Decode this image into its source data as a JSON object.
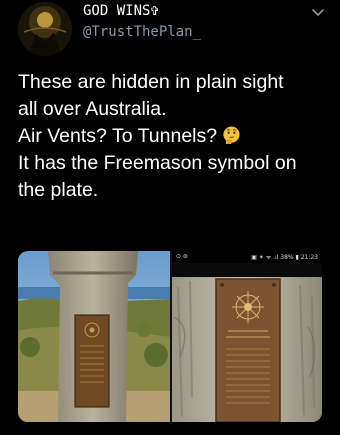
{
  "user": {
    "display_name": "GOD WINS✞",
    "handle": "@TrustThePlan_"
  },
  "tweet": {
    "lines": [
      "These are hidden in plain sight",
      "all over Australia.",
      "Air Vents? To Tunnels?",
      "It has the Freemason symbol on",
      "the plate."
    ],
    "emoji": "thinking-face"
  },
  "media": {
    "photo2_status_left": "⊙ ⊚",
    "photo2_status_right": "▣ ✶ ᯤ .ıl 38% ▮ 21:23"
  },
  "colors": {
    "background": "#000000",
    "text": "#ffffff",
    "secondary_text": "#8899a6"
  }
}
